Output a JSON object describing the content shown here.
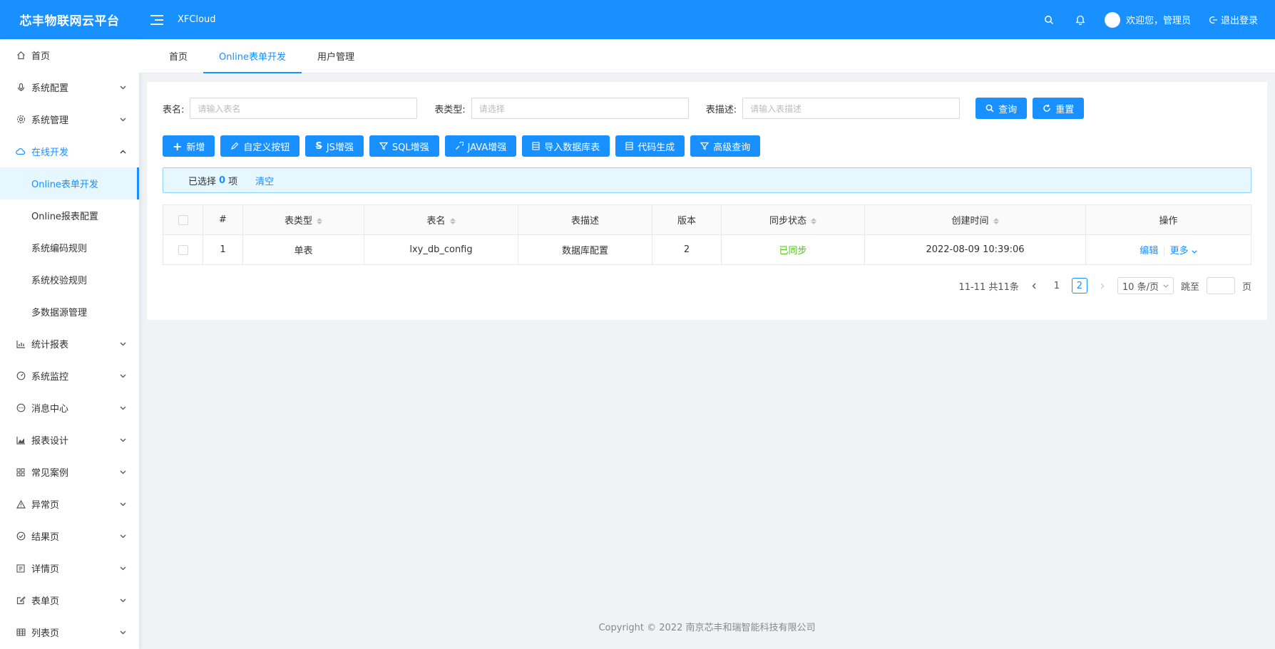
{
  "header": {
    "logo": "芯丰物联网云平台",
    "brand": "XFCloud",
    "welcome": "欢迎您，管理员",
    "logout": "退出登录"
  },
  "sidebar": {
    "items": [
      {
        "label": "首页",
        "icon": "home-icon"
      },
      {
        "label": "系统配置",
        "icon": "mic-icon"
      },
      {
        "label": "系统管理",
        "icon": "gear-icon"
      },
      {
        "label": "在线开发",
        "icon": "cloud-icon"
      },
      {
        "label": "统计报表",
        "icon": "bar-chart-icon"
      },
      {
        "label": "系统监控",
        "icon": "dashboard-icon"
      },
      {
        "label": "消息中心",
        "icon": "message-icon"
      },
      {
        "label": "报表设计",
        "icon": "area-chart-icon"
      },
      {
        "label": "常见案例",
        "icon": "appstore-icon"
      },
      {
        "label": "异常页",
        "icon": "warning-icon"
      },
      {
        "label": "结果页",
        "icon": "check-circle-icon"
      },
      {
        "label": "详情页",
        "icon": "profile-icon"
      },
      {
        "label": "表单页",
        "icon": "form-icon"
      },
      {
        "label": "列表页",
        "icon": "table-icon"
      }
    ],
    "sub_items": [
      "Online表单开发",
      "Online报表配置",
      "系统编码规则",
      "系统校验规则",
      "多数据源管理"
    ]
  },
  "tabs": [
    "首页",
    "Online表单开发",
    "用户管理"
  ],
  "search": {
    "table_name_label": "表名:",
    "table_name_placeholder": "请输入表名",
    "table_type_label": "表类型:",
    "table_type_placeholder": "请选择",
    "table_desc_label": "表描述:",
    "table_desc_placeholder": "请输入表描述",
    "query_button": "查询",
    "reset_button": "重置"
  },
  "toolbar": {
    "add": "新增",
    "custom_button": "自定义按钮",
    "js": "JS增强",
    "sql": "SQL增强",
    "java": "JAVA增强",
    "import_db": "导入数据库表",
    "code_gen": "代码生成",
    "advanced_query": "高级查询"
  },
  "alert": {
    "prefix": "已选择",
    "count": "0",
    "suffix": "项",
    "clear": "清空"
  },
  "table": {
    "headers": [
      "#",
      "表类型",
      "表名",
      "表描述",
      "版本",
      "同步状态",
      "创建时间",
      "操作"
    ],
    "rows": [
      {
        "index": "1",
        "type": "单表",
        "name": "lxy_db_config",
        "desc": "数据库配置",
        "version": "2",
        "status": "已同步",
        "created": "2022-08-09 10:39:06",
        "edit": "编辑",
        "more": "更多"
      }
    ]
  },
  "pager": {
    "total": "11-11 共11条",
    "pages": [
      "1",
      "2"
    ],
    "current_page": "2",
    "page_size": "10 条/页",
    "jump_label": "跳至",
    "page_suffix": "页"
  },
  "footer": "Copyright © 2022 南京芯丰和瑞智能科技有限公司",
  "colors": {
    "primary": "#1890ff",
    "success": "#52c41a",
    "alert_bg": "#e6f7ff"
  }
}
